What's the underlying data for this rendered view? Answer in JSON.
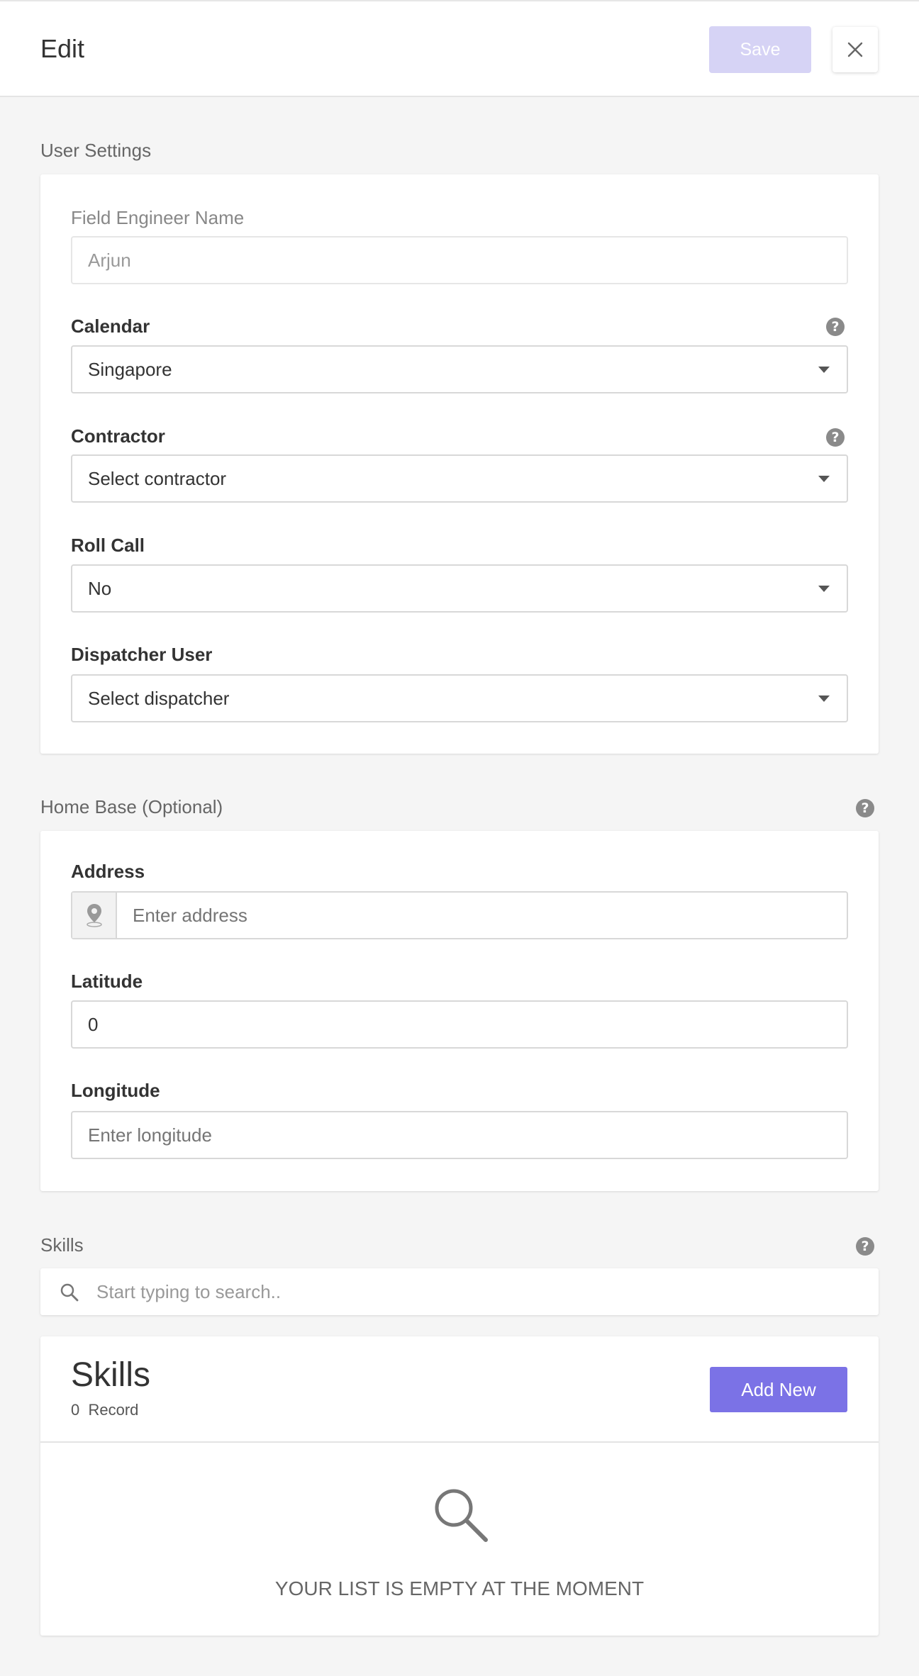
{
  "header": {
    "title": "Edit",
    "save_label": "Save"
  },
  "user_settings": {
    "section_title": "User Settings",
    "engineer_name_label": "Field Engineer Name",
    "engineer_name_value": "Arjun",
    "calendar_label": "Calendar",
    "calendar_value": "Singapore",
    "contractor_label": "Contractor",
    "contractor_value": "Select contractor",
    "roll_call_label": "Roll Call",
    "roll_call_value": "No",
    "dispatcher_label": "Dispatcher User",
    "dispatcher_value": "Select dispatcher"
  },
  "home_base": {
    "section_title": "Home Base (Optional)",
    "address_label": "Address",
    "address_placeholder": "Enter address",
    "latitude_label": "Latitude",
    "latitude_value": "0",
    "longitude_label": "Longitude",
    "longitude_placeholder": "Enter longitude"
  },
  "skills": {
    "section_title": "Skills",
    "search_placeholder": "Start typing to search..",
    "list_title": "Skills",
    "record_count": "0",
    "record_label": "Record",
    "add_new_label": "Add New",
    "empty_message": "YOUR LIST IS EMPTY AT THE MOMENT"
  },
  "icons": {
    "help": "?",
    "close": "close-icon",
    "map_pin": "map-pin-icon",
    "search": "search-icon"
  },
  "colors": {
    "accent": "#7b72e6",
    "save_disabled": "#d6d3f5",
    "page_bg": "#f5f5f5"
  }
}
